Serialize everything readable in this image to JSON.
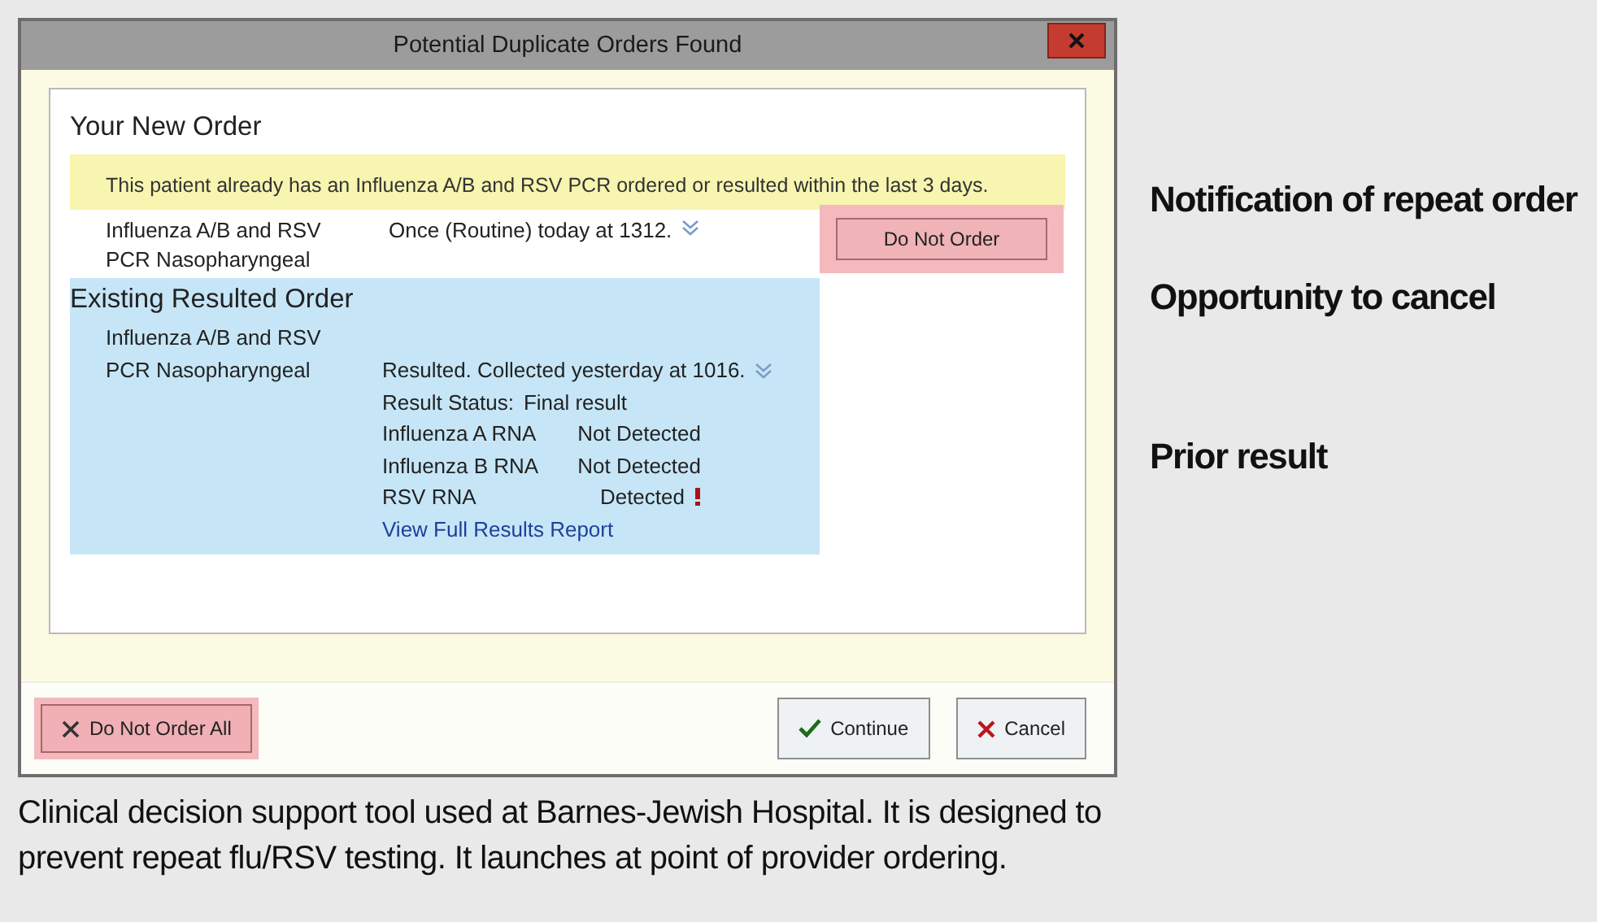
{
  "dialog": {
    "title": "Potential Duplicate Orders Found"
  },
  "new_order": {
    "heading": "Your New Order",
    "warning": "This patient already has an Influenza A/B and RSV PCR ordered or resulted within the last 3 days.",
    "order_name": "Influenza A/B and RSV PCR Nasopharyngeal",
    "order_detail": "Once (Routine) today at 1312.",
    "action": {
      "label": "Do Not Order",
      "highlighted": true
    }
  },
  "existing_order": {
    "heading": "Existing Resulted Order",
    "order_name": "Influenza A/B and RSV PCR Nasopharyngeal",
    "status_line": "Resulted. Collected yesterday at 1016.",
    "result_status_label": "Result Status:",
    "result_status": "Final result",
    "results": [
      {
        "name": "Influenza A RNA",
        "value": "Not Detected",
        "abnormal": false
      },
      {
        "name": "Influenza B RNA",
        "value": "Not Detected",
        "abnormal": false
      },
      {
        "name": "RSV RNA",
        "value": "Detected",
        "abnormal": true
      }
    ],
    "link": "View Full Results Report"
  },
  "footer": {
    "buttons": [
      {
        "label": "Do Not Order All",
        "kind": "dismiss",
        "highlighted": true
      },
      {
        "label": "Continue",
        "kind": "confirm",
        "highlighted": false
      },
      {
        "label": "Cancel",
        "kind": "cancel",
        "highlighted": false
      }
    ]
  },
  "annotations": [
    "Notification of repeat order",
    "Opportunity to cancel",
    "Prior result"
  ],
  "caption": "Clinical decision support tool used at Barnes-Jewish Hospital. It is designed to prevent repeat flu/RSV testing. It launches at point of provider ordering."
}
